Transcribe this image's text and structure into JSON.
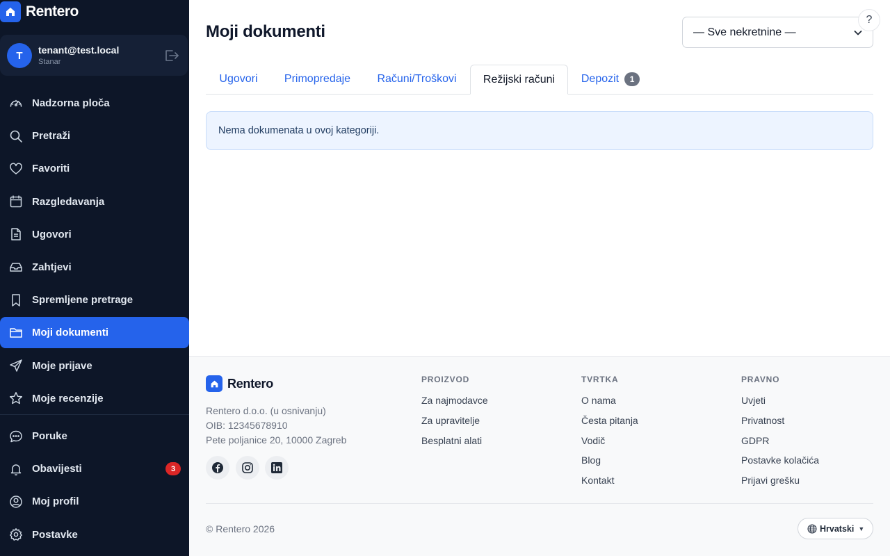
{
  "app": {
    "name": "Rentero"
  },
  "user": {
    "initial": "T",
    "email": "tenant@test.local",
    "role": "Stanar"
  },
  "sidebar": {
    "items": [
      {
        "label": "Nadzorna ploča",
        "icon": "dashboard-icon"
      },
      {
        "label": "Pretraži",
        "icon": "search-icon"
      },
      {
        "label": "Favoriti",
        "icon": "heart-icon"
      },
      {
        "label": "Razgledavanja",
        "icon": "calendar-icon"
      },
      {
        "label": "Ugovori",
        "icon": "document-icon"
      },
      {
        "label": "Zahtjevi",
        "icon": "inbox-icon"
      },
      {
        "label": "Spremljene pretrage",
        "icon": "bookmark-icon"
      },
      {
        "label": "Moji dokumenti",
        "icon": "folder-icon",
        "active": true
      },
      {
        "label": "Moje prijave",
        "icon": "send-icon"
      },
      {
        "label": "Moje recenzije",
        "icon": "star-icon"
      }
    ],
    "secondary": [
      {
        "label": "Poruke",
        "icon": "chat-icon"
      },
      {
        "label": "Obavijesti",
        "icon": "bell-icon",
        "badge": "3"
      },
      {
        "label": "Moj profil",
        "icon": "user-circle-icon"
      },
      {
        "label": "Postavke",
        "icon": "gear-icon"
      }
    ]
  },
  "main": {
    "title": "Moji dokumenti",
    "property_select": {
      "selected": "— Sve nekretnine —"
    },
    "help_label": "?",
    "tabs": [
      {
        "label": "Ugovori"
      },
      {
        "label": "Primopredaje"
      },
      {
        "label": "Računi/Troškovi"
      },
      {
        "label": "Režijski računi",
        "active": true
      },
      {
        "label": "Depozit",
        "badge": "1"
      }
    ],
    "empty_message": "Nema dokumenata u ovoj kategoriji."
  },
  "footer": {
    "brand": "Rentero",
    "company": "Rentero d.o.o. (u osnivanju)",
    "oib": "OIB: 12345678910",
    "address": "Pete poljanice 20, 10000 Zagreb",
    "social": [
      "facebook-icon",
      "instagram-icon",
      "linkedin-icon"
    ],
    "columns": [
      {
        "title": "PROIZVOD",
        "links": [
          "Za najmodavce",
          "Za upravitelje",
          "Besplatni alati"
        ]
      },
      {
        "title": "TVRTKA",
        "links": [
          "O nama",
          "Česta pitanja",
          "Vodič",
          "Blog",
          "Kontakt"
        ]
      },
      {
        "title": "PRAVNO",
        "links": [
          "Uvjeti",
          "Privatnost",
          "GDPR",
          "Postavke kolačića",
          "Prijavi grešku"
        ]
      }
    ],
    "copyright": "© Rentero 2026",
    "language": "Hrvatski"
  },
  "colors": {
    "accent": "#2563eb",
    "sidebar_bg": "#0d1628",
    "badge_red": "#dc2626"
  }
}
